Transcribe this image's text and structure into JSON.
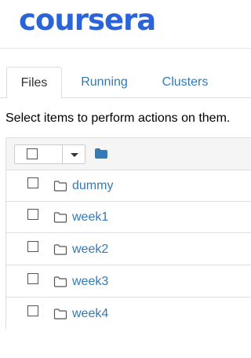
{
  "brand": {
    "logo_text": "coursera",
    "colors": {
      "logo": "#2a64d8",
      "link": "#337ab7",
      "border": "#dddddd",
      "header_bg": "#f5f5f5"
    }
  },
  "tabs": [
    {
      "label": "Files",
      "active": true
    },
    {
      "label": "Running",
      "active": false
    },
    {
      "label": "Clusters",
      "active": false
    }
  ],
  "instructions": "Select items to perform actions on them.",
  "list_header": {
    "select_all_checked": false,
    "dropdown_icon": "caret-down-icon",
    "folder_icon": "folder-solid-icon"
  },
  "items": [
    {
      "name": "dummy",
      "type": "folder",
      "checked": false
    },
    {
      "name": "week1",
      "type": "folder",
      "checked": false
    },
    {
      "name": "week2",
      "type": "folder",
      "checked": false
    },
    {
      "name": "week3",
      "type": "folder",
      "checked": false
    },
    {
      "name": "week4",
      "type": "folder",
      "checked": false
    }
  ]
}
